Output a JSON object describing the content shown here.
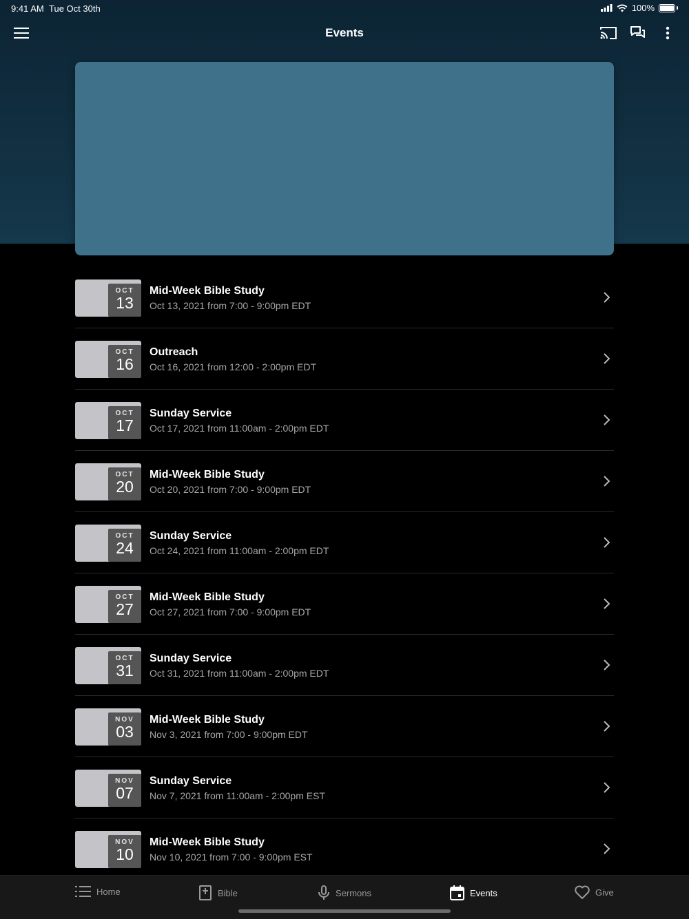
{
  "status_bar": {
    "time": "9:41 AM",
    "date": "Tue Oct 30th",
    "battery": "100%"
  },
  "nav": {
    "title": "Events"
  },
  "events": [
    {
      "month": "OCT",
      "day": "13",
      "title": "Mid-Week Bible Study",
      "subtitle": "Oct 13, 2021 from 7:00 - 9:00pm EDT"
    },
    {
      "month": "OCT",
      "day": "16",
      "title": "Outreach",
      "subtitle": "Oct 16, 2021 from 12:00 - 2:00pm EDT"
    },
    {
      "month": "OCT",
      "day": "17",
      "title": "Sunday Service",
      "subtitle": "Oct 17, 2021 from 11:00am - 2:00pm EDT"
    },
    {
      "month": "OCT",
      "day": "20",
      "title": "Mid-Week Bible Study",
      "subtitle": "Oct 20, 2021 from 7:00 - 9:00pm EDT"
    },
    {
      "month": "OCT",
      "day": "24",
      "title": "Sunday Service",
      "subtitle": "Oct 24, 2021 from 11:00am - 2:00pm EDT"
    },
    {
      "month": "OCT",
      "day": "27",
      "title": "Mid-Week Bible Study",
      "subtitle": "Oct 27, 2021 from 7:00 - 9:00pm EDT"
    },
    {
      "month": "OCT",
      "day": "31",
      "title": "Sunday Service",
      "subtitle": "Oct 31, 2021 from 11:00am - 2:00pm EDT"
    },
    {
      "month": "NOV",
      "day": "03",
      "title": "Mid-Week Bible Study",
      "subtitle": "Nov 3, 2021 from 7:00 - 9:00pm EDT"
    },
    {
      "month": "NOV",
      "day": "07",
      "title": "Sunday Service",
      "subtitle": "Nov 7, 2021 from 11:00am - 2:00pm EST"
    },
    {
      "month": "NOV",
      "day": "10",
      "title": "Mid-Week Bible Study",
      "subtitle": "Nov 10, 2021 from 7:00 - 9:00pm EST"
    }
  ],
  "tabs": [
    {
      "label": "Home",
      "icon": "list-icon"
    },
    {
      "label": "Bible",
      "icon": "bible-icon"
    },
    {
      "label": "Sermons",
      "icon": "microphone-icon"
    },
    {
      "label": "Events",
      "icon": "calendar-icon",
      "active": true
    },
    {
      "label": "Give",
      "icon": "heart-icon"
    }
  ],
  "colors": {
    "hero": "#40718a",
    "header_bg": "#15384b",
    "badge": "#555555",
    "thumb": "#c4c4c8"
  }
}
